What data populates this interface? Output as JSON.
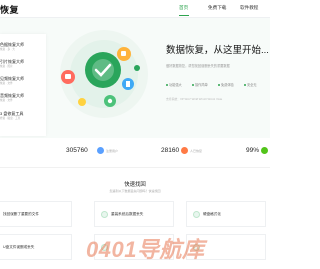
{
  "header": {
    "logo": "恢复",
    "nav": [
      "首页",
      "免费下载",
      "软件教程"
    ],
    "active_index": 0
  },
  "sidebar": {
    "items": [
      {
        "title": "色据恢复大师",
        "sub": "恢复 · 多 · 大"
      },
      {
        "title": "引片恢复大师",
        "sub": "恢复 · 照片"
      },
      {
        "title": "见频恢复大师",
        "sub": "恢复 · 文件"
      },
      {
        "title": "音频恢复大师",
        "sub": "恢复 · 文件"
      },
      {
        "title": "3 盘修复工具",
        "sub": "修复 · 磁盘 · 工具"
      }
    ]
  },
  "hero": {
    "title": "数据恢复，从这里开始...",
    "desc": "做好数据恢复，帮您找回误删丢失的重要数据",
    "tags": [
      "功能强大",
      "操作简单",
      "免费体验",
      "安全无"
    ],
    "meta": "支持系统：XP  Win7  Win8  Win10  Win11  Vista"
  },
  "stats": [
    {
      "value": "305760",
      "label": "注册用户",
      "color": "#5aa0ff"
    },
    {
      "value": "28160",
      "label": "人已恢复",
      "color": "#ff7a45"
    },
    {
      "value": "99%",
      "label": "",
      "color": "#52c41a"
    }
  ],
  "quick": {
    "title": "快速找回",
    "subtitle": "您遇到以下数据丢失问题吗？快速找回",
    "cards": [
      "找回误删了重要的文件",
      "重装系统后数据丢失",
      "硬盘格式化",
      "U盘文件误删或丢失",
      "",
      ""
    ]
  },
  "watermark": "0401导航库",
  "colors": {
    "accent": "#2ea44f",
    "hero_bg": "#f7fbf9"
  }
}
